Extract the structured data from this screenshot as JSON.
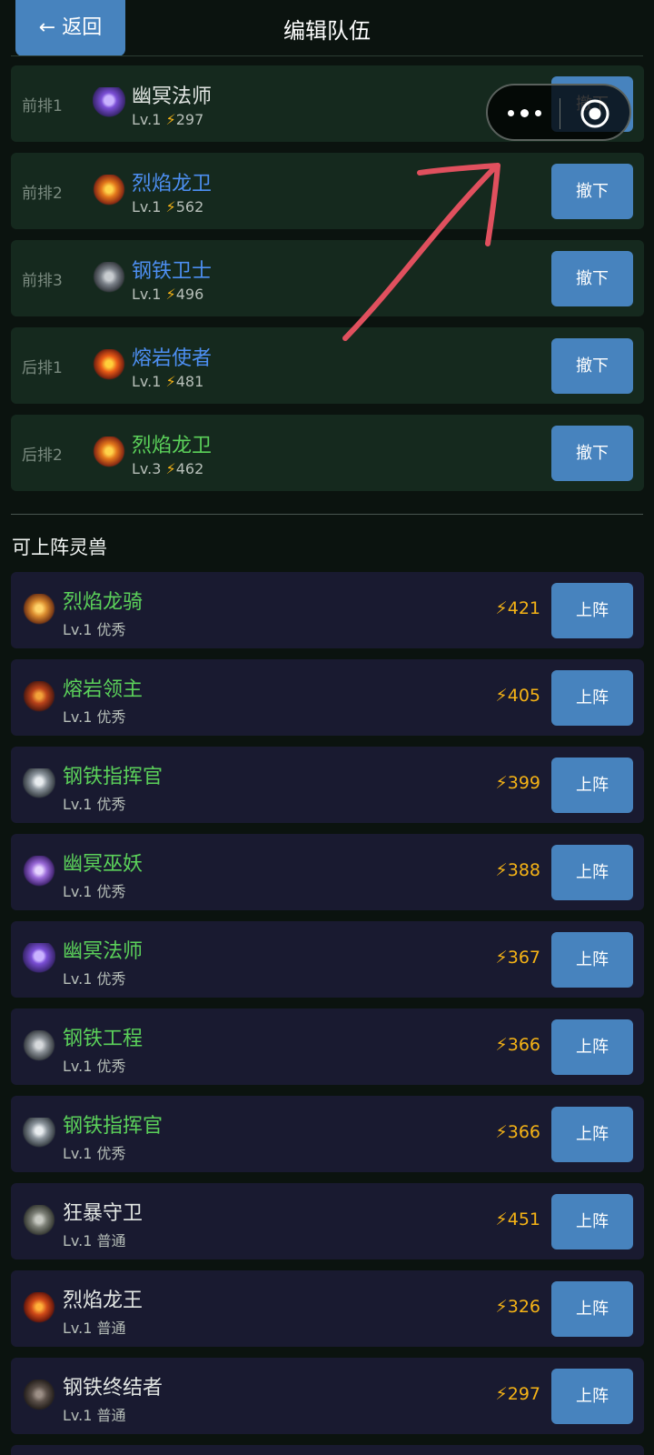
{
  "header": {
    "back_label": "← 返回",
    "title": "编辑队伍"
  },
  "team_slots": [
    {
      "position": "前排1",
      "name": "幽冥法师",
      "sub": "Lv.1 ⚡297",
      "name_color": "white",
      "sprite": "phantom-mage-sprite",
      "button": "撤下"
    },
    {
      "position": "前排2",
      "name": "烈焰龙卫",
      "sub": "Lv.1 ⚡562",
      "name_color": "blue",
      "sprite": "flame-dragon-guard-sprite",
      "button": "撤下"
    },
    {
      "position": "前排3",
      "name": "钢铁卫士",
      "sub": "Lv.1 ⚡496",
      "name_color": "blue",
      "sprite": "steel-guardian-sprite",
      "button": "撤下"
    },
    {
      "position": "后排1",
      "name": "熔岩使者",
      "sub": "Lv.1 ⚡481",
      "name_color": "blue",
      "sprite": "lava-envoy-sprite",
      "button": "撤下"
    },
    {
      "position": "后排2",
      "name": "烈焰龙卫",
      "sub": "Lv.3 ⚡462",
      "name_color": "green",
      "sprite": "flame-dragon-guard-sprite",
      "button": "撤下"
    }
  ],
  "available_title": "可上阵灵兽",
  "available": [
    {
      "name": "烈焰龙骑",
      "sub": "Lv.1 优秀",
      "power": "⚡421",
      "name_color": "green",
      "sprite": "flame-dragon-rider-sprite",
      "button": "上阵"
    },
    {
      "name": "熔岩领主",
      "sub": "Lv.1 优秀",
      "power": "⚡405",
      "name_color": "green",
      "sprite": "lava-lord-sprite",
      "button": "上阵"
    },
    {
      "name": "钢铁指挥官",
      "sub": "Lv.1 优秀",
      "power": "⚡399",
      "name_color": "green",
      "sprite": "steel-commander-sprite",
      "button": "上阵"
    },
    {
      "name": "幽冥巫妖",
      "sub": "Lv.1 优秀",
      "power": "⚡388",
      "name_color": "green",
      "sprite": "phantom-lich-sprite",
      "button": "上阵"
    },
    {
      "name": "幽冥法师",
      "sub": "Lv.1 优秀",
      "power": "⚡367",
      "name_color": "green",
      "sprite": "phantom-mage-sprite",
      "button": "上阵"
    },
    {
      "name": "钢铁工程",
      "sub": "Lv.1 优秀",
      "power": "⚡366",
      "name_color": "green",
      "sprite": "steel-engineer-sprite",
      "button": "上阵"
    },
    {
      "name": "钢铁指挥官",
      "sub": "Lv.1 优秀",
      "power": "⚡366",
      "name_color": "green",
      "sprite": "steel-commander-sprite",
      "button": "上阵"
    },
    {
      "name": "狂暴守卫",
      "sub": "Lv.1 普通",
      "power": "⚡451",
      "name_color": "white",
      "sprite": "berserk-guard-sprite",
      "button": "上阵"
    },
    {
      "name": "烈焰龙王",
      "sub": "Lv.1 普通",
      "power": "⚡326",
      "name_color": "white",
      "sprite": "flame-dragon-king-sprite",
      "button": "上阵"
    },
    {
      "name": "钢铁终结者",
      "sub": "Lv.1 普通",
      "power": "⚡297",
      "name_color": "white",
      "sprite": "steel-terminator-sprite",
      "button": "上阵"
    }
  ],
  "colors": {
    "accent": "#4783be",
    "slot_bg": "#15291e",
    "item_bg": "#191a30",
    "rarity_white": "#e2e6e3",
    "rarity_blue": "#4d8ff2",
    "rarity_green": "#5bd15a",
    "power": "#f5b316",
    "annotation": "#e0505e"
  },
  "capsule": {
    "menu_icon": "more-dots-icon",
    "close_icon": "target-circle-icon"
  }
}
